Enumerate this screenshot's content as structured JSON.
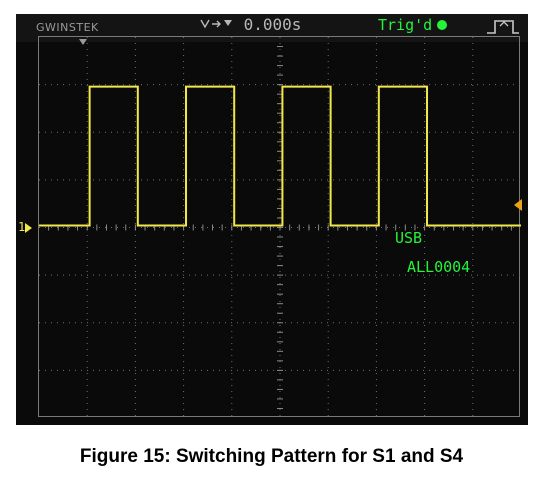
{
  "scope": {
    "brand": "GWINSTEK",
    "time_offset": "0.000s",
    "trigger_status": "Trig'd",
    "channel_marker": "1",
    "storage_label": "USB",
    "file_name": "ALL0004",
    "colors": {
      "trace": "#f2e84a",
      "readout": "#27f23a",
      "grid": "#6f6f6f",
      "background": "#0a0a0a",
      "trigger_marker": "#e8a317"
    },
    "icons": [
      "pan-arrow-icon",
      "trigger-position-icon",
      "trigger-dot-icon",
      "rising-edge-icon",
      "trigger-level-icon"
    ],
    "graticule": {
      "horizontal_divisions": 10,
      "vertical_divisions": 8
    },
    "waveform": {
      "type": "square",
      "pulses": 4,
      "low_level_div": 0,
      "high_level_div": 3
    }
  },
  "caption": "Figure 15: Switching Pattern for S1 and S4"
}
